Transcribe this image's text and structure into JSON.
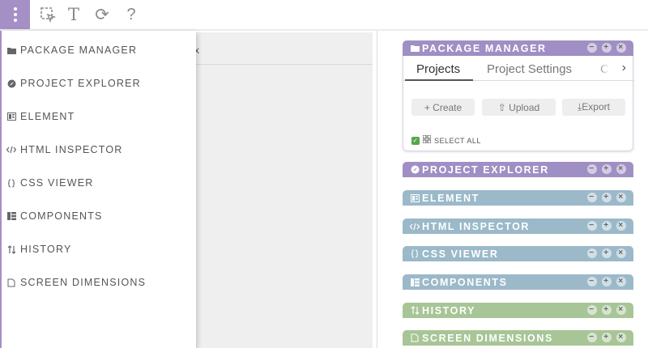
{
  "toolbar": {
    "menu_icon": "vertical-dots-icon",
    "select_icon": "selection-icon",
    "text_tool_glyph": "T",
    "refresh_glyph": "⟳",
    "help_glyph": "?"
  },
  "canvas": {
    "close_glyph": "x"
  },
  "side_menu": {
    "items": [
      {
        "label": "PACKAGE MANAGER",
        "icon": "folder-icon"
      },
      {
        "label": "PROJECT EXPLORER",
        "icon": "compass-icon"
      },
      {
        "label": "ELEMENT",
        "icon": "element-icon"
      },
      {
        "label": "HTML INSPECTOR",
        "icon": "code-icon"
      },
      {
        "label": "CSS VIEWER",
        "icon": "css-icon"
      },
      {
        "label": "COMPONENTS",
        "icon": "components-icon"
      },
      {
        "label": "HISTORY",
        "icon": "history-icon"
      },
      {
        "label": "SCREEN DIMENSIONS",
        "icon": "screen-icon"
      }
    ]
  },
  "panels": {
    "package_manager": {
      "title": "PACKAGE MANAGER",
      "tabs": [
        "Projects",
        "Project Settings",
        "C"
      ],
      "buttons": {
        "create": "+ Create",
        "upload": "⇧ Upload",
        "export": "⤓Export"
      },
      "select_all": "SELECT ALL"
    },
    "collapsed": [
      {
        "title": "PROJECT EXPLORER",
        "color": "purple"
      },
      {
        "title": "ELEMENT",
        "color": "blue"
      },
      {
        "title": "HTML INSPECTOR",
        "color": "blue"
      },
      {
        "title": "CSS VIEWER",
        "color": "blue"
      },
      {
        "title": "COMPONENTS",
        "color": "blue"
      },
      {
        "title": "HISTORY",
        "color": "green"
      },
      {
        "title": "SCREEN DIMENSIONS",
        "color": "green"
      }
    ],
    "controls": {
      "minimize": "−",
      "expand": "+",
      "close": "×"
    }
  },
  "colors": {
    "purple": "#a08fc4",
    "blue": "#9bb9c9",
    "green": "#a7c596",
    "check": "#57a64b"
  }
}
